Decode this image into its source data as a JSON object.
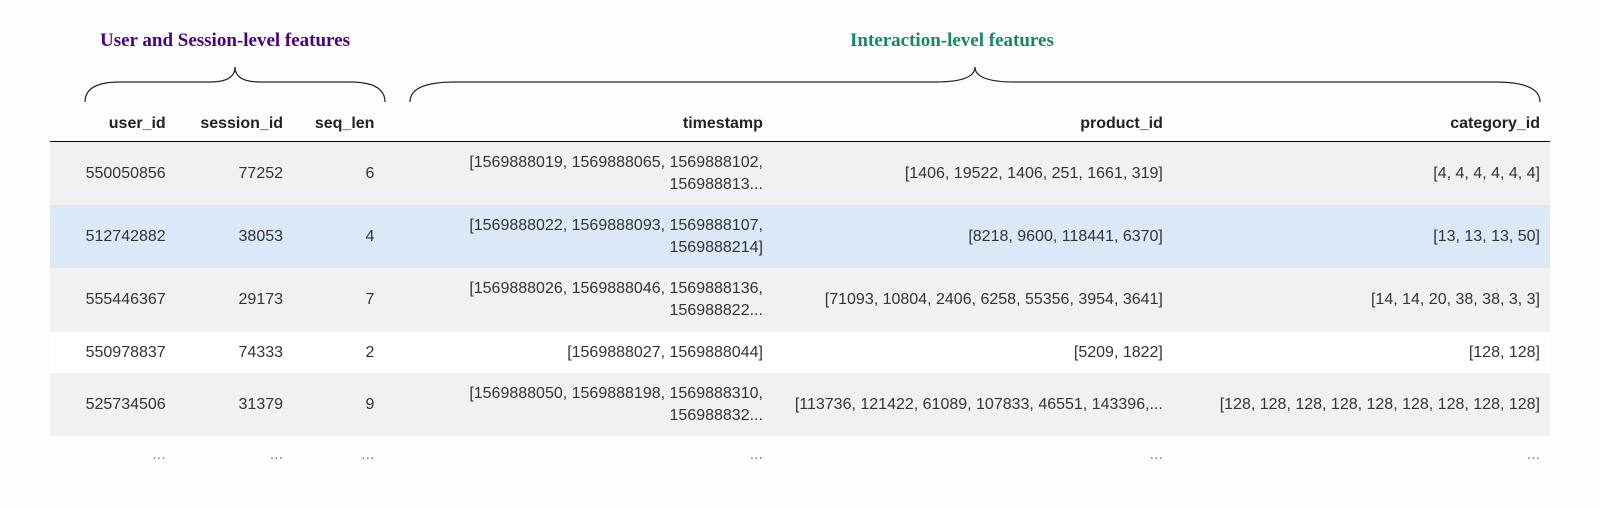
{
  "group_labels": {
    "left": "User and Session-level features",
    "right": "Interaction-level features"
  },
  "columns": {
    "user_id": "user_id",
    "session_id": "session_id",
    "seq_len": "seq_len",
    "timestamp": "timestamp",
    "product_id": "product_id",
    "category_id": "category_id"
  },
  "rows": [
    {
      "user_id": "550050856",
      "session_id": "77252",
      "seq_len": "6",
      "timestamp": "[1569888019, 1569888065, 1569888102, 156988813...",
      "product_id": "[1406, 19522, 1406, 251, 1661, 319]",
      "category_id": "[4, 4, 4, 4, 4, 4]",
      "highlight": false
    },
    {
      "user_id": "512742882",
      "session_id": "38053",
      "seq_len": "4",
      "timestamp": "[1569888022, 1569888093, 1569888107, 1569888214]",
      "product_id": "[8218, 9600, 118441, 6370]",
      "category_id": "[13, 13, 13, 50]",
      "highlight": true
    },
    {
      "user_id": "555446367",
      "session_id": "29173",
      "seq_len": "7",
      "timestamp": "[1569888026, 1569888046, 1569888136, 156988822...",
      "product_id": "[71093, 10804, 2406, 6258, 55356, 3954, 3641]",
      "category_id": "[14, 14, 20, 38, 38, 3, 3]",
      "highlight": false
    },
    {
      "user_id": "550978837",
      "session_id": "74333",
      "seq_len": "2",
      "timestamp": "[1569888027, 1569888044]",
      "product_id": "[5209, 1822]",
      "category_id": "[128, 128]",
      "highlight": false
    },
    {
      "user_id": "525734506",
      "session_id": "31379",
      "seq_len": "9",
      "timestamp": "[1569888050, 1569888198, 1569888310, 156988832...",
      "product_id": "[113736, 121422, 61089, 107833, 46551, 143396,...",
      "category_id": "[128, 128, 128, 128, 128, 128, 128, 128, 128]",
      "highlight": false
    }
  ],
  "ellipsis": "..."
}
